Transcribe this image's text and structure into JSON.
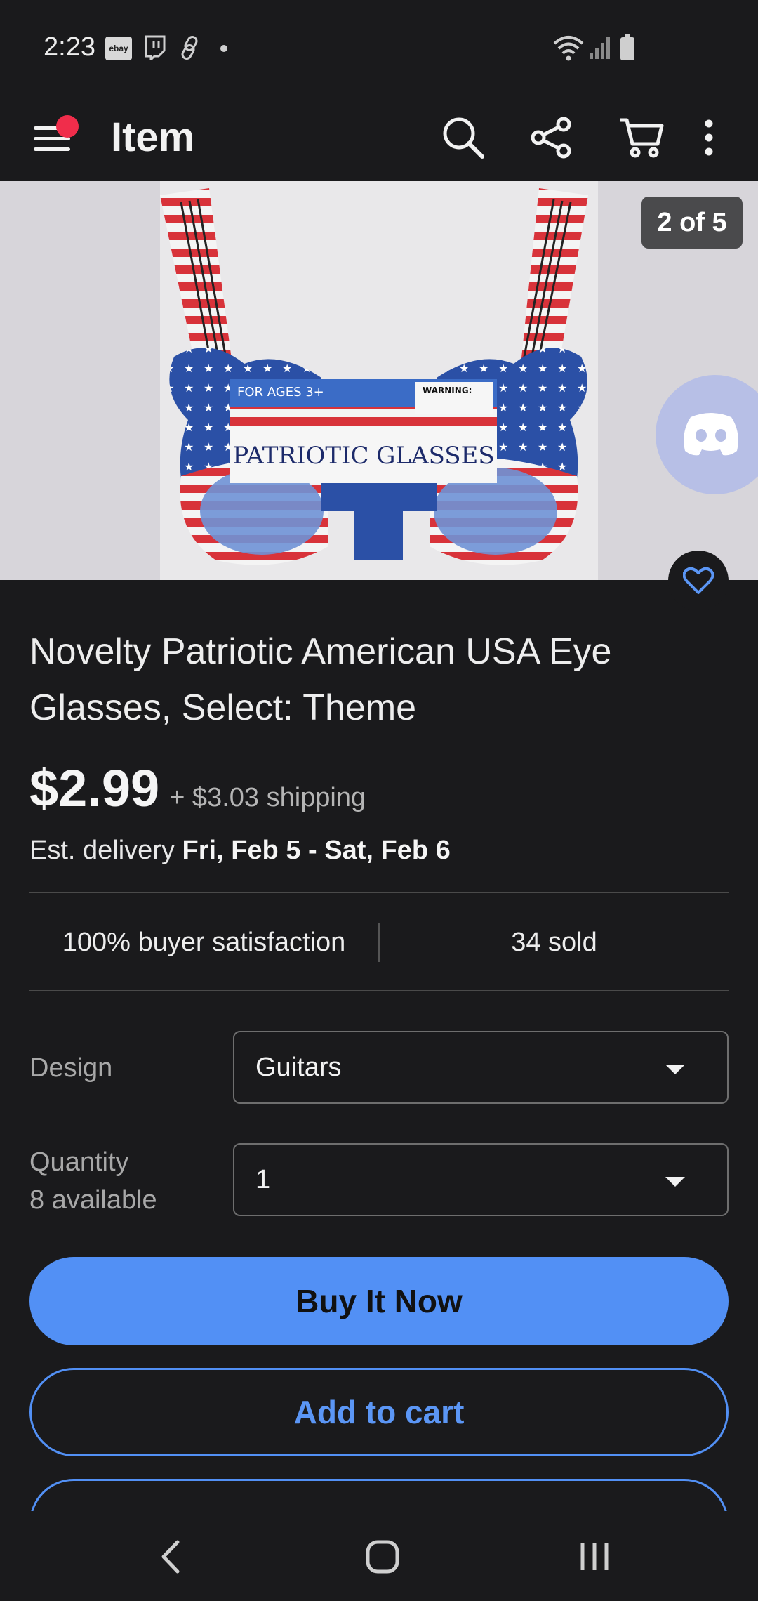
{
  "status_bar": {
    "time": "2:23",
    "ebay_badge": "ebay",
    "icons": [
      "ebay-icon",
      "twitch-icon",
      "link-icon",
      "wifi-icon",
      "signal-icon",
      "battery-icon"
    ]
  },
  "app_bar": {
    "title": "Item",
    "icons": [
      "menu-icon",
      "search-icon",
      "share-icon",
      "cart-icon",
      "more-vertical-icon"
    ]
  },
  "gallery": {
    "counter": "2 of 5",
    "image_text": {
      "ages": "FOR AGES 3+",
      "warning": "WARNING:",
      "product_label": "PATRIOTIC GLASSES"
    }
  },
  "listing": {
    "title": "Novelty Patriotic American USA Eye Glasses, Select: Theme",
    "price": "$2.99",
    "shipping": "+ $3.03 shipping",
    "delivery_prefix": "Est. delivery",
    "delivery_dates": "Fri, Feb 5 - Sat, Feb 6",
    "buyer_satisfaction": "100% buyer satisfaction",
    "sold": "34 sold"
  },
  "options": {
    "design_label": "Design",
    "design_value": "Guitars",
    "quantity_label": "Quantity",
    "quantity_available": "8 available",
    "quantity_value": "1"
  },
  "actions": {
    "buy_now": "Buy It Now",
    "add_to_cart": "Add to cart"
  },
  "colors": {
    "accent": "#5290f5",
    "background": "#1a1a1c",
    "notification": "#f02d4b"
  }
}
